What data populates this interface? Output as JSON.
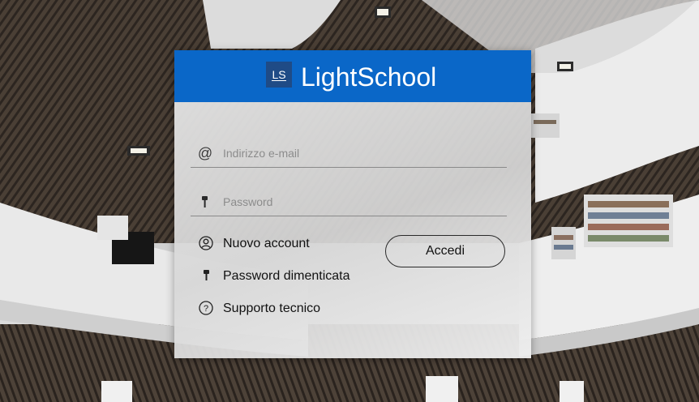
{
  "brand": {
    "logo_text": "LS",
    "name": "LightSchool",
    "header_color": "#0a67c8"
  },
  "login": {
    "email_placeholder": "Indirizzo e-mail",
    "email_icon": "at-icon",
    "password_placeholder": "Password",
    "password_icon": "key-icon",
    "submit_label": "Accedi"
  },
  "links": [
    {
      "label": "Nuovo account",
      "icon": "user-circle-icon"
    },
    {
      "label": "Password dimenticata",
      "icon": "key-icon"
    },
    {
      "label": "Supporto tecnico",
      "icon": "help-circle-icon"
    }
  ]
}
